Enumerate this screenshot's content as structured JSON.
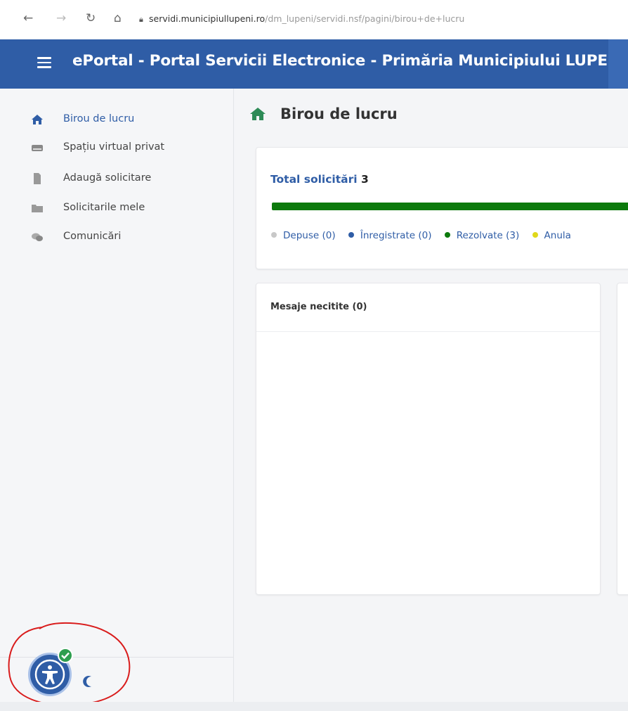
{
  "browser": {
    "url_host": "servidi.municipiullupeni.ro",
    "url_path": "/dm_lupeni/servidi.nsf/pagini/birou+de+lucru"
  },
  "header": {
    "title": "ePortal - Portal Servicii Electronice - Primăria Municipiului LUPENI"
  },
  "sidebar": {
    "items": [
      {
        "label": "Birou de lucru",
        "icon": "home-icon",
        "active": true
      },
      {
        "label": "Spațiu virtual privat",
        "icon": "drive-icon"
      },
      {
        "label": "Adaugă solicitare",
        "icon": "file-icon"
      },
      {
        "label": "Solicitarile mele",
        "icon": "folder-icon"
      },
      {
        "label": "Comunicări",
        "icon": "comments-icon"
      }
    ]
  },
  "main": {
    "page_title": "Birou de lucru",
    "total": {
      "label": "Total solicitări",
      "count": "3",
      "progress_rezolvate": 1.0
    },
    "legend": [
      {
        "label": "Depuse (0)",
        "color": "#c8c8c8"
      },
      {
        "label": "Înregistrate (0)",
        "color": "#2f5da6"
      },
      {
        "label": "Rezolvate (3)",
        "color": "#0d7a0d"
      },
      {
        "label": "Anula",
        "color": "#e0d81a"
      }
    ],
    "messages_card": {
      "title": "Mesaje necitite (0)"
    }
  },
  "colors": {
    "brand": "#2f5da6",
    "progress": "#0d7a0d"
  }
}
